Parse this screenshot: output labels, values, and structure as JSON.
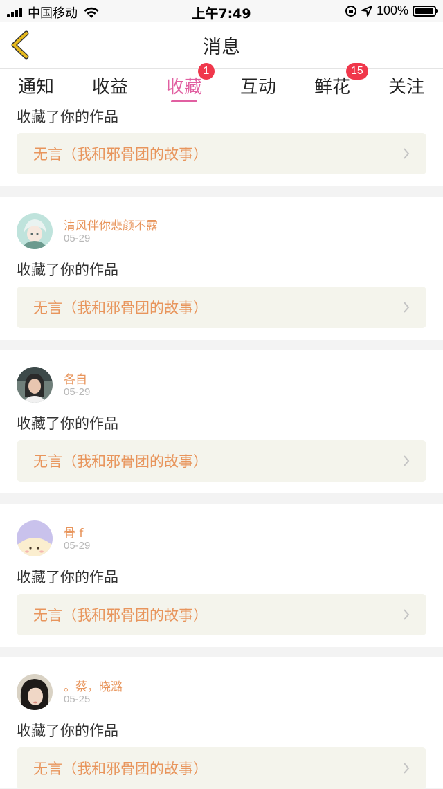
{
  "status_bar": {
    "carrier": "中国移动",
    "time": "上午7:49",
    "battery": "100%"
  },
  "nav": {
    "title": "消息"
  },
  "tabs": [
    {
      "label": "通知"
    },
    {
      "label": "收益"
    },
    {
      "label": "收藏",
      "badge": "1",
      "active": true
    },
    {
      "label": "互动"
    },
    {
      "label": "鲜花",
      "badge": "15"
    },
    {
      "label": "关注"
    }
  ],
  "feed": [
    {
      "action": "收藏了你的作品",
      "work": "无言（我和邪骨团的故事）"
    },
    {
      "user": "清风伴你悲颜不露",
      "date": "05-29",
      "action": "收藏了你的作品",
      "work": "无言（我和邪骨团的故事）"
    },
    {
      "user": "各自",
      "date": "05-29",
      "action": "收藏了你的作品",
      "work": "无言（我和邪骨团的故事）"
    },
    {
      "user": "骨 f",
      "date": "05-29",
      "action": "收藏了你的作品",
      "work": "无言（我和邪骨团的故事）"
    },
    {
      "user": "。蔡，晓潞",
      "date": "05-25",
      "action": "收藏了你的作品",
      "work": "无言（我和邪骨团的故事）"
    }
  ],
  "colors": {
    "accent": "#e15fa1",
    "badge": "#f0374b",
    "username": "#e8955c",
    "work_bg": "#f4f4ec",
    "back_arrow": "#e6b91e"
  }
}
